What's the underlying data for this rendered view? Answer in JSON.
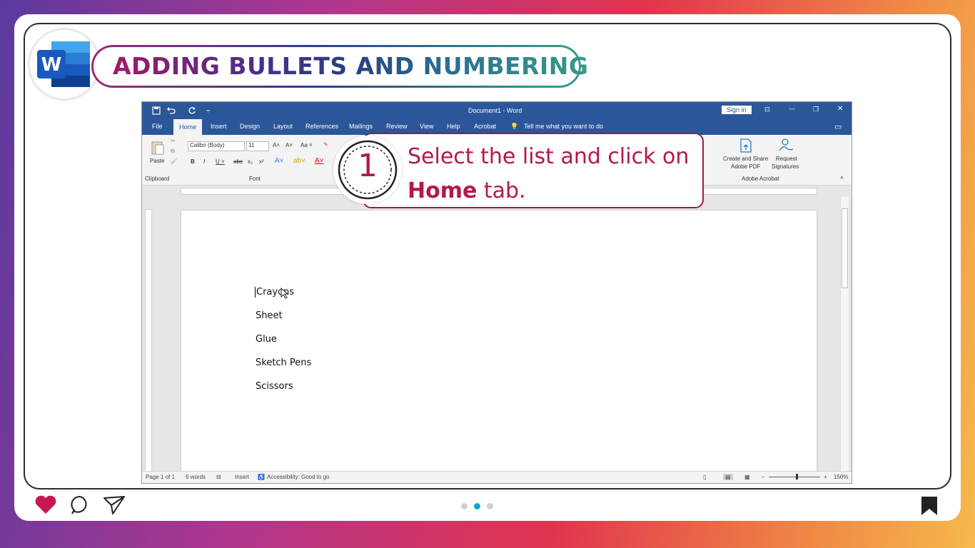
{
  "banner": {
    "title": "ADDING BULLETS AND NUMBERING"
  },
  "word": {
    "doc_title": "Document1  -  Word",
    "sign_in": "Sign in",
    "tabs": [
      "File",
      "Home",
      "Insert",
      "Design",
      "Layout",
      "References",
      "Mailings",
      "Review",
      "View",
      "Help",
      "Acrobat"
    ],
    "tell_me": "Tell me what you want to do",
    "ribbon": {
      "paste": "Paste",
      "clipboard_group": "Clipboard",
      "font_group": "Font",
      "font_name": "Calibri (Body)",
      "font_size": "11",
      "acrobat_create": "Create and Share",
      "acrobat_create2": "Adobe PDF",
      "acrobat_request": "Request",
      "acrobat_request2": "Signatures",
      "acrobat_group": "Adobe Acrobat"
    },
    "document_lines": [
      "Crayons",
      "Sheet",
      "Glue",
      "Sketch Pens",
      "Scissors"
    ],
    "status": {
      "page": "Page 1 of 1",
      "words": "6 words",
      "mode": "Insert",
      "accessibility": "Accessibility: Good to go",
      "zoom": "150%"
    }
  },
  "callout": {
    "step": "1",
    "line1": "Select the list and click on",
    "bold": "Home",
    "rest": " tab."
  },
  "pager": {
    "active_index": 1,
    "count": 3
  },
  "colors": {
    "word_blue": "#2b579a",
    "callout": "#b5174e",
    "heart": "#c8174f"
  }
}
